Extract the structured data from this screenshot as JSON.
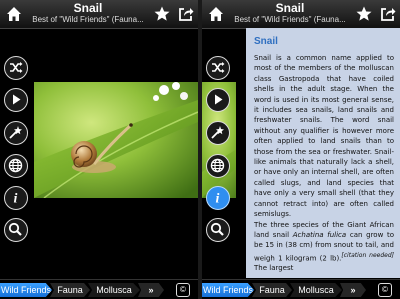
{
  "header": {
    "title": "Snail",
    "subtitle": "Best of \"Wild Friends\" (Fauna..."
  },
  "icons": {
    "home": "home-icon",
    "favorite": "star-icon",
    "share": "share-icon",
    "shuffle": "shuffle-icon",
    "play": "play-icon",
    "magic": "magic-wand-icon",
    "web": "globe-icon",
    "info": "info-icon",
    "search": "magnifier-icon"
  },
  "article": {
    "title": "Snail",
    "p1": "Snail is a common name applied to most of the members of the molluscan class Gastropoda that have coiled shells in the adult stage. When the word is used in its most general sense, it includes sea snails, land snails and freshwater snails. The word snail without any qualifier is however more often applied to land snails than to those from the sea or freshwater. Snail-like animals that naturally lack a shell, or have only an internal shell, are often called slugs, and land species that have only a very small shell (that they cannot retract into) are often called semislugs.",
    "p2a": "The three species of the Giant African land snail ",
    "p2_italic": "Achatina fulica",
    "p2b": " can grow to be 15 in (38 cm) from snout to tail, and weigh 1 kilogram (2 lb).",
    "citation": "[citation needed]",
    "p2c": " The largest"
  },
  "breadcrumb": {
    "items": [
      "Wild Friends",
      "Fauna",
      "Mollusca"
    ],
    "more": "»",
    "copyright": "©"
  },
  "colors": {
    "accent": "#2f8ef0",
    "article_bg": "#c8d3e6",
    "article_title": "#2f6fc0"
  }
}
